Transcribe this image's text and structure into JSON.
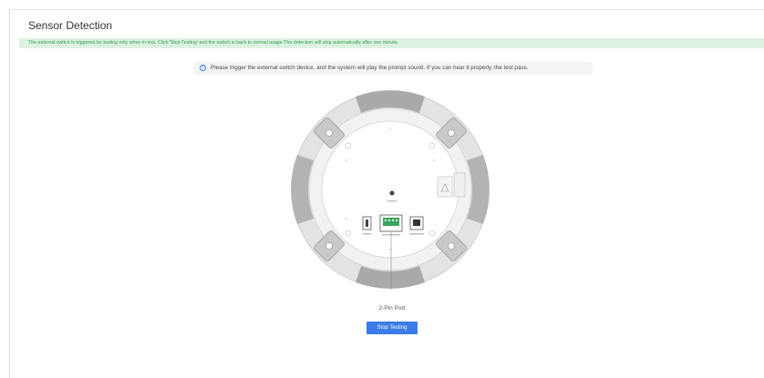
{
  "panel": {
    "title": "Sensor Detection"
  },
  "banner": {
    "text": "The external switch is triggered for testing only when in test. Click 'Stop Testing' and the switch is back to normal usage.The detection will stop automatically after one minute."
  },
  "notice": {
    "icon": "info-circle-icon",
    "text": "Please trigger the external switch device, and the system will play the prompt sound. If you can hear it properly, the test pass."
  },
  "device": {
    "port_label": "2-Pin Port"
  },
  "actions": {
    "stop_label": "Stop Testing"
  },
  "colors": {
    "accent": "#3b7bea",
    "banner_bg": "#dcf3e1",
    "banner_text": "#2f9a4a",
    "notice_bg": "#f3f4f6"
  }
}
